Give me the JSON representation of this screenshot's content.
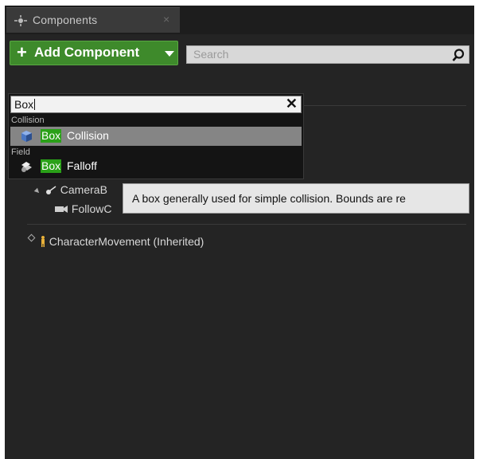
{
  "tab": {
    "title": "Components",
    "close": "×",
    "icon": "components-icon"
  },
  "toolbar": {
    "add_plus": "+",
    "add_label": "Add Component",
    "search_placeholder": "Search",
    "search_icon": "search-icon"
  },
  "tree": {
    "camera_boom_label": "CameraB",
    "follow_camera_label": "FollowC",
    "character_movement_label": "CharacterMovement (Inherited)"
  },
  "popup": {
    "query": "Box",
    "clear": "✕",
    "categories": [
      {
        "name": "Collision",
        "item": {
          "match": "Box",
          "rest": "Collision",
          "icon": "box-collision-icon",
          "selected": true
        }
      },
      {
        "name": "Field",
        "item": {
          "match": "Box",
          "rest": "Falloff",
          "icon": "box-falloff-icon",
          "selected": false
        }
      }
    ]
  },
  "tooltip": {
    "text": "A box generally used for simple collision. Bounds are re"
  },
  "colors": {
    "accent_green": "#3e8a2b",
    "highlight_green": "#2aa018",
    "selection": "#858585"
  }
}
